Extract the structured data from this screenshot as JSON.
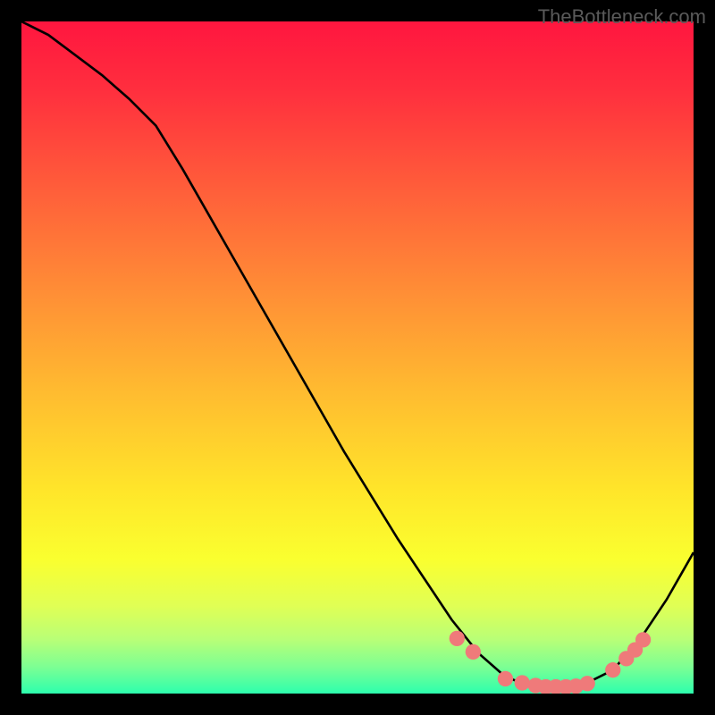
{
  "watermark": "TheBottleneck.com",
  "chart_data": {
    "type": "line",
    "title": "",
    "xlabel": "",
    "ylabel": "",
    "xlim": [
      0,
      100
    ],
    "ylim": [
      0,
      100
    ],
    "curve": {
      "x": [
        0,
        4,
        8,
        12,
        16,
        20,
        24,
        28,
        32,
        36,
        40,
        44,
        48,
        52,
        56,
        60,
        64,
        68,
        72,
        76,
        80,
        84,
        88,
        92,
        96,
        100
      ],
      "y": [
        100,
        98,
        95,
        92,
        88.5,
        84.5,
        78,
        71,
        64,
        57,
        50,
        43,
        36,
        29.5,
        23,
        17,
        11,
        6,
        2.5,
        1,
        1,
        1.5,
        3.5,
        8,
        14,
        21
      ]
    },
    "dots": {
      "x": [
        64.8,
        67.2,
        72,
        74.5,
        76.5,
        78,
        79.5,
        81,
        82.5,
        84.2,
        88,
        90,
        91.3,
        92.5
      ],
      "y": [
        8.2,
        6.2,
        2.2,
        1.6,
        1.2,
        1.0,
        1.0,
        1.0,
        1.1,
        1.5,
        3.5,
        5.2,
        6.5,
        8.0
      ]
    },
    "gradient_stops": [
      {
        "offset": 0.0,
        "color": "#ff163f"
      },
      {
        "offset": 0.1,
        "color": "#ff2e3e"
      },
      {
        "offset": 0.25,
        "color": "#ff5e3a"
      },
      {
        "offset": 0.4,
        "color": "#ff8d36"
      },
      {
        "offset": 0.55,
        "color": "#ffbb30"
      },
      {
        "offset": 0.7,
        "color": "#ffe62a"
      },
      {
        "offset": 0.8,
        "color": "#faff2f"
      },
      {
        "offset": 0.87,
        "color": "#e0ff55"
      },
      {
        "offset": 0.92,
        "color": "#b8ff77"
      },
      {
        "offset": 0.96,
        "color": "#7dff93"
      },
      {
        "offset": 1.0,
        "color": "#2dffad"
      }
    ],
    "dot_color": "#ef7a7a",
    "curve_color": "#000000"
  }
}
